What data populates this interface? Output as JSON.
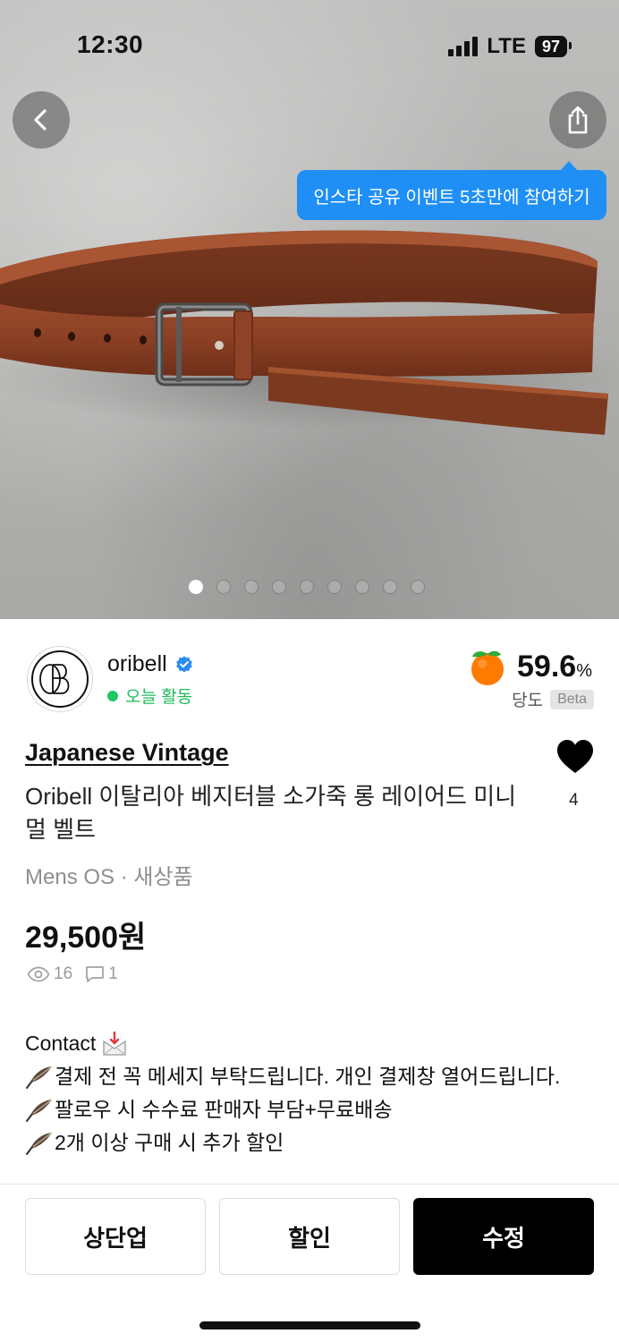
{
  "status_bar": {
    "time": "12:30",
    "network": "LTE",
    "battery": "97"
  },
  "header": {
    "back_icon": "chevron-left-icon",
    "share_icon": "share-icon"
  },
  "promo_tooltip": "인스타 공유 이벤트 5초만에 참여하기",
  "gallery": {
    "image_count": 9,
    "active_index": 0
  },
  "seller": {
    "name": "oribell",
    "verified": true,
    "activity": "오늘 활동",
    "avatar_monogram": "OB",
    "sweetness_value": "59.6",
    "sweetness_unit": "%",
    "sweetness_label": "당도",
    "beta_badge": "Beta"
  },
  "product": {
    "brand": "Japanese Vintage",
    "title": "Oribell 이탈리아 베지터블 소가죽 롱 레이어드 미니멀 벨트",
    "meta": "Mens OS · 새상품",
    "price": "29,500원",
    "likes": "4",
    "views": "16",
    "chats": "1"
  },
  "description": {
    "line1": "Contact",
    "line2": "결제 전 꼭 메세지 부탁드립니다. 개인 결제창 열어드립니다.",
    "line3": "팔로우 시 수수료 판매자 부담+무료배송",
    "line4": "2개 이상 구매 시 추가 할인"
  },
  "actions": {
    "bump": "상단업",
    "discount": "할인",
    "edit": "수정"
  },
  "colors": {
    "accent_blue": "#1f8ff5",
    "active_green": "#1fc662",
    "primary_black": "#000000"
  }
}
